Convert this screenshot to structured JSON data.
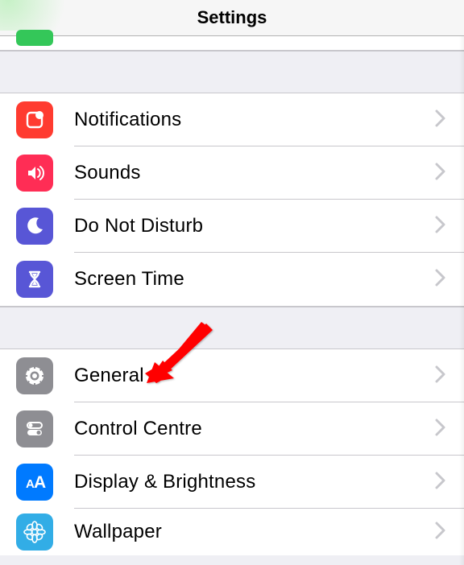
{
  "header": {
    "title": "Settings"
  },
  "group1": [
    {
      "label": "Notifications",
      "icon": "notifications-icon",
      "bg": "bg-red"
    },
    {
      "label": "Sounds",
      "icon": "sounds-icon",
      "bg": "bg-pink"
    },
    {
      "label": "Do Not Disturb",
      "icon": "moon-icon",
      "bg": "bg-indigo"
    },
    {
      "label": "Screen Time",
      "icon": "hourglass-icon",
      "bg": "bg-indigo2"
    }
  ],
  "group2": [
    {
      "label": "General",
      "icon": "gear-icon",
      "bg": "bg-gray"
    },
    {
      "label": "Control Centre",
      "icon": "toggles-icon",
      "bg": "bg-gray2"
    },
    {
      "label": "Display & Brightness",
      "icon": "text-size-icon",
      "bg": "bg-blue"
    },
    {
      "label": "Wallpaper",
      "icon": "flower-icon",
      "bg": "bg-cyan"
    }
  ],
  "annotation": {
    "type": "arrow",
    "target_label": "General"
  }
}
